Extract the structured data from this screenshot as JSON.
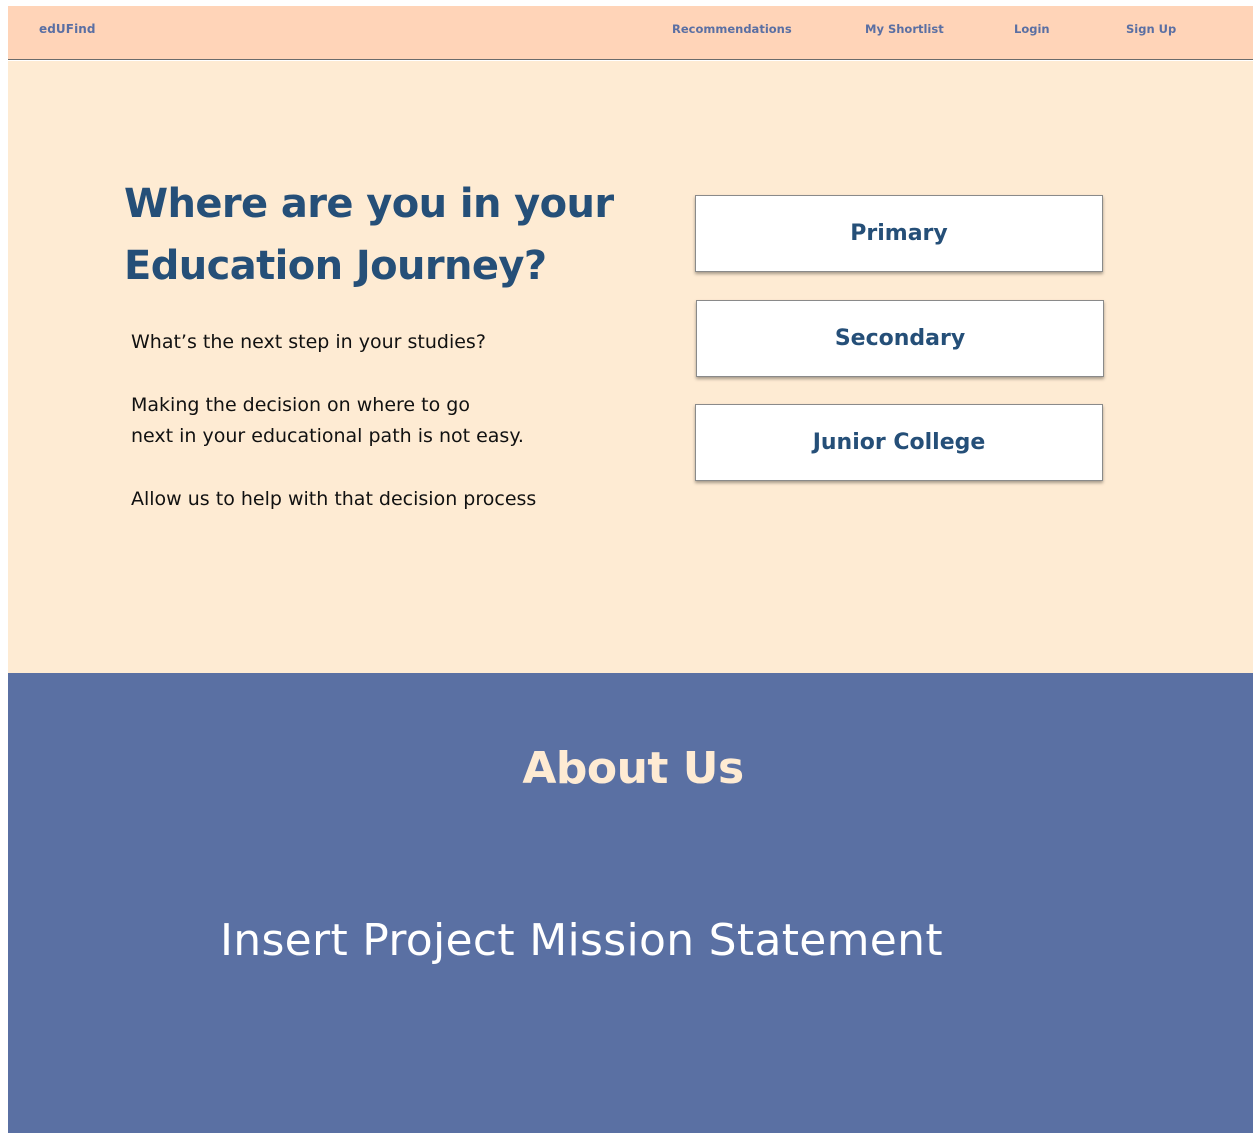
{
  "navbar": {
    "brand": "edUFind",
    "links": {
      "recommendations": "Recommendations",
      "shortlist": "My Shortlist",
      "login": "Login",
      "signup": "Sign Up"
    }
  },
  "hero": {
    "title_line1": "Where are you in your",
    "title_line2": "Education Journey?",
    "text1": "What’s the next step in your studies?",
    "text2": "Making the decision on where to go",
    "text3": "next in your educational path is not easy.",
    "text4": "Allow us to help with that decision process",
    "levels": [
      "Primary",
      "Secondary",
      "Junior College"
    ]
  },
  "about": {
    "title": "About Us",
    "mission": "Insert Project Mission Statement"
  },
  "colors": {
    "navbar_bg": "#FFD4B8",
    "hero_bg": "#FEEBD3",
    "about_bg": "#5A70A3",
    "primary_text": "#254F78",
    "nav_text": "#5A6FA3"
  }
}
